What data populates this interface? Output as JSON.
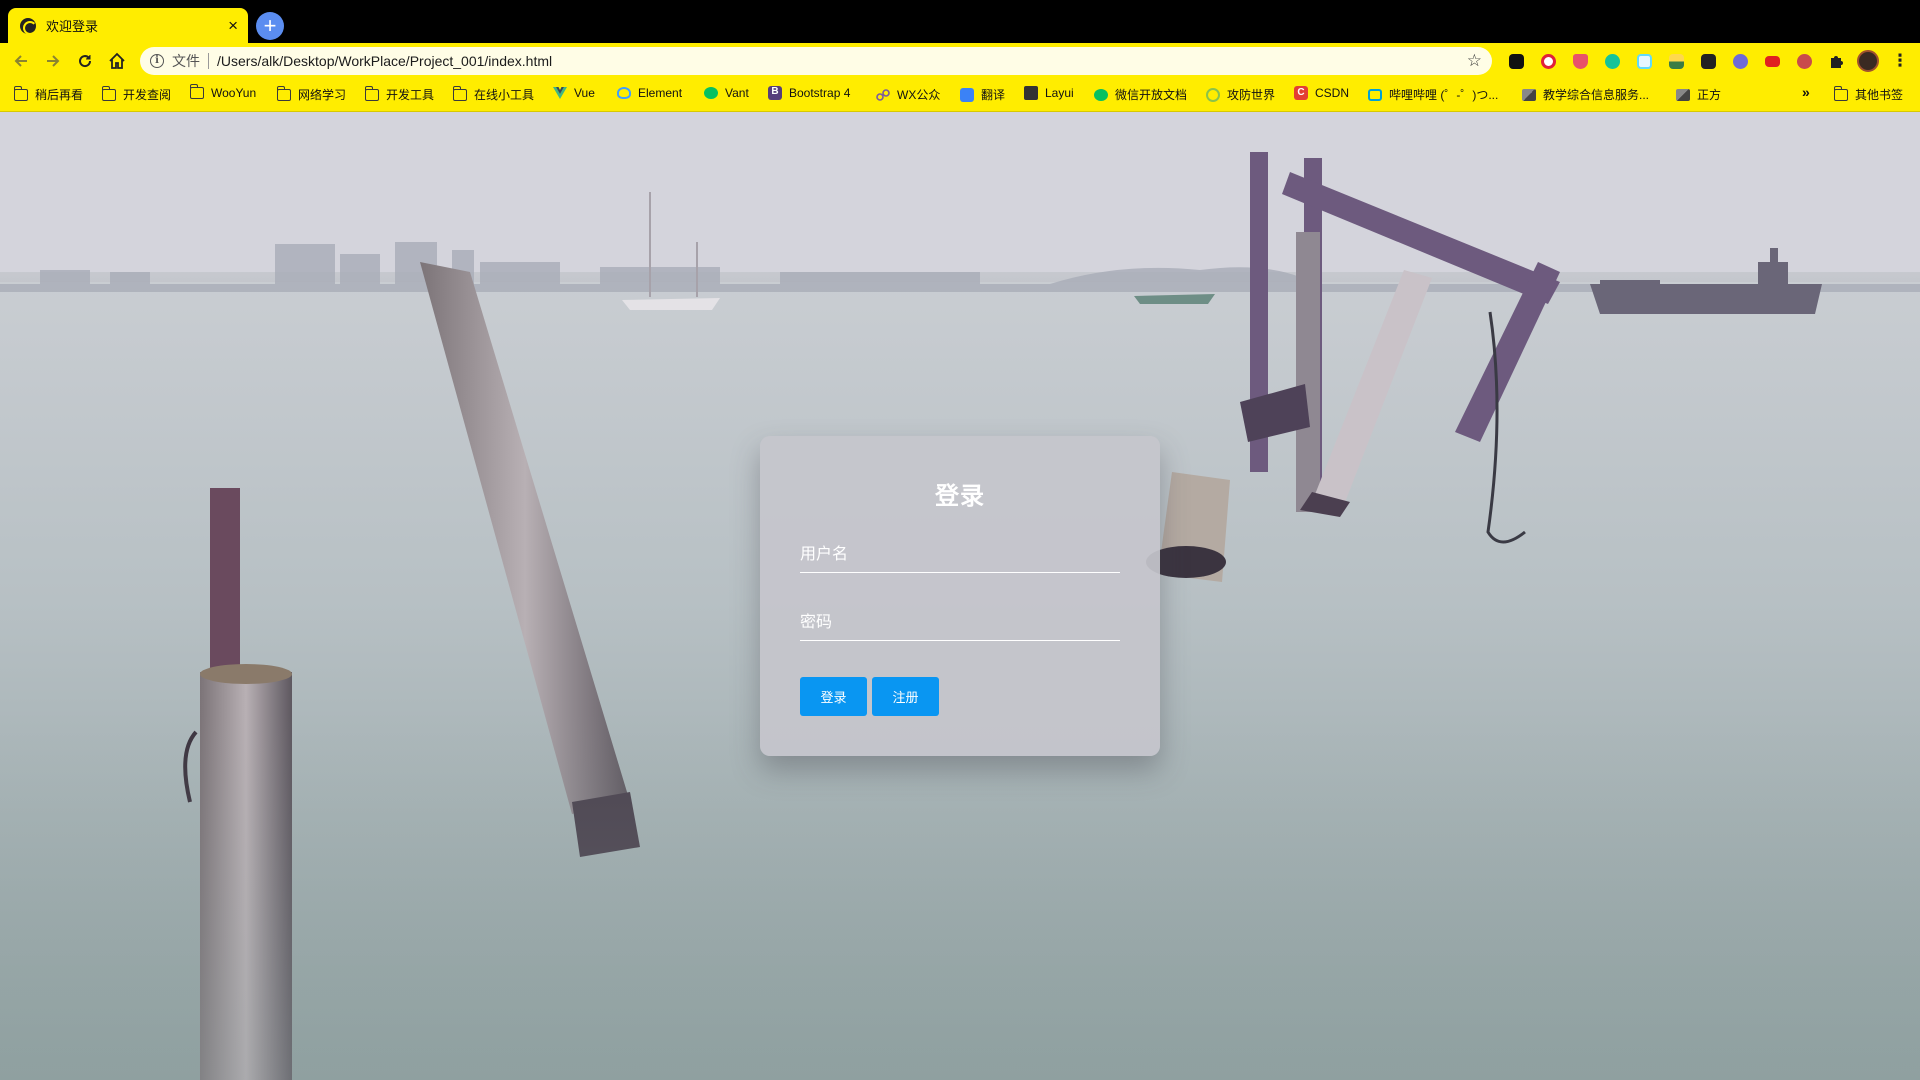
{
  "browser": {
    "tab": {
      "title": "欢迎登录",
      "close_glyph": "×"
    },
    "new_tab_glyph": "+",
    "toolbar": {
      "back_icon": "arrow-left-icon",
      "forward_icon": "arrow-right-icon",
      "reload_icon": "reload-icon",
      "home_icon": "home-icon",
      "scheme_label": "文件",
      "url": "/Users/alk/Desktop/WorkPlace/Project_001/index.html",
      "extensions": [
        {
          "icon": "ghost-extension-icon",
          "color": "#111111"
        },
        {
          "icon": "infinity-extension-icon",
          "color": "#e0203a"
        },
        {
          "icon": "shield-extension-icon",
          "color": "#e8526a"
        },
        {
          "icon": "grammarly-extension-icon",
          "color": "#15c39a"
        },
        {
          "icon": "react-devtools-icon",
          "color": "#61dafb"
        },
        {
          "icon": "landscape-extension-icon",
          "color": "#3a7d44"
        },
        {
          "icon": "github-extension-icon",
          "color": "#222222"
        },
        {
          "icon": "owl-extension-icon",
          "color": "#6f6ad6"
        },
        {
          "icon": "youtube-extension-icon",
          "color": "#e02020"
        },
        {
          "icon": "tampermonkey-extension-icon",
          "color": "#c94b4b"
        },
        {
          "icon": "puzzle-extensions-icon",
          "color": "#222222"
        }
      ]
    },
    "bookmarks": {
      "items": [
        {
          "label": "稍后再看",
          "icon": "folder-icon",
          "color": ""
        },
        {
          "label": "开发查阅",
          "icon": "folder-icon",
          "color": ""
        },
        {
          "label": "WooYun",
          "icon": "folder-icon",
          "color": ""
        },
        {
          "label": "网络学习",
          "icon": "folder-icon",
          "color": ""
        },
        {
          "label": "开发工具",
          "icon": "folder-icon",
          "color": ""
        },
        {
          "label": "在线小工具",
          "icon": "folder-icon",
          "color": ""
        },
        {
          "label": "Vue",
          "icon": "vue-icon",
          "color": "#41b883"
        },
        {
          "label": "Element",
          "icon": "element-icon",
          "color": "#409eff"
        },
        {
          "label": "Vant",
          "icon": "vant-icon",
          "color": "#07c160"
        },
        {
          "label": "Bootstrap 4",
          "icon": "bootstrap-icon",
          "color": "#563d7c"
        },
        {
          "label": "WX公众",
          "icon": "link-icon",
          "color": "#7a5aa0"
        },
        {
          "label": "翻译",
          "icon": "translate-icon",
          "color": "#3b82f6"
        },
        {
          "label": "Layui",
          "icon": "layui-icon",
          "color": "#333333"
        },
        {
          "label": "微信开放文档",
          "icon": "wechat-icon",
          "color": "#07c160"
        },
        {
          "label": "攻防世界",
          "icon": "globe-icon",
          "color": "#8ac34a"
        },
        {
          "label": "CSDN",
          "icon": "csdn-icon",
          "color": "#e33e33"
        },
        {
          "label": "哔哩哔哩 (゜-゜)つ...",
          "icon": "bilibili-icon",
          "color": "#00a1d6"
        },
        {
          "label": "教学综合信息服务...",
          "icon": "school-icon",
          "color": "#555555"
        },
        {
          "label": "正方",
          "icon": "school-icon",
          "color": "#555555"
        }
      ],
      "overflow_glyph": "»",
      "other_bookmarks": "其他书签"
    }
  },
  "login": {
    "title": "登录",
    "username_placeholder": "用户名",
    "password_placeholder": "密码",
    "login_button": "登录",
    "register_button": "注册"
  },
  "colors": {
    "browser_theme": "#ffed00",
    "button_blue": "#0996f2"
  }
}
